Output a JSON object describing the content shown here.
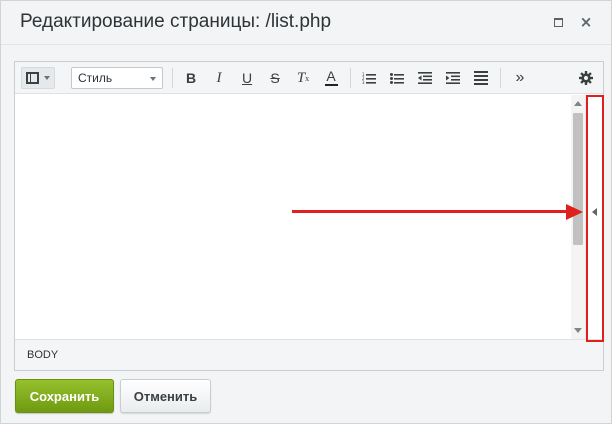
{
  "dialog": {
    "title": "Редактирование страницы: /list.php",
    "maximize_icon": "maximize-icon",
    "close_glyph": "×"
  },
  "toolbar": {
    "view_mode_icon": "film-strip-icon",
    "style_select": {
      "label": "Стиль"
    },
    "bold": "B",
    "italic": "I",
    "underline": "U",
    "strikethrough": "S",
    "clear_format": "T",
    "clear_format_sub": "x",
    "font_color": "A",
    "ordered_list_icon": "ordered-list-icon",
    "unordered_list_icon": "unordered-list-icon",
    "outdent_icon": "outdent-icon",
    "indent_icon": "indent-icon",
    "justify_icon": "align-justify-icon",
    "more": "»",
    "settings_icon": "gear-icon"
  },
  "status_bar": {
    "path": "BODY"
  },
  "buttons": {
    "save": "Сохранить",
    "cancel": "Отменить"
  },
  "colors": {
    "save_green": "#7ba91c",
    "annotation_red": "#e01f1f",
    "dialog_bg": "#f2f4f5"
  }
}
